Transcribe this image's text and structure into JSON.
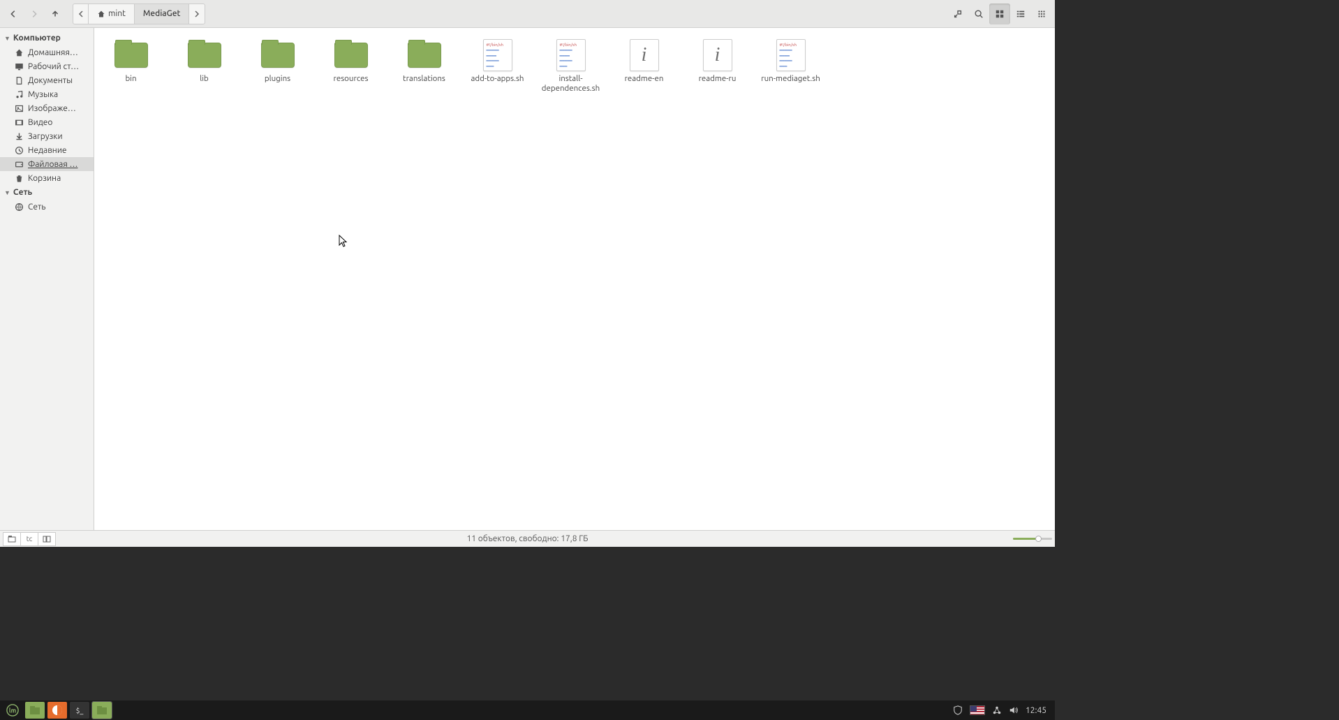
{
  "toolbar": {
    "path": {
      "parent": "mint",
      "current": "MediaGet"
    }
  },
  "sidebar": {
    "section_computer": "Компьютер",
    "section_network": "Сеть",
    "items_computer": [
      {
        "label": "Домашняя…",
        "icon": "home"
      },
      {
        "label": "Рабочий ст…",
        "icon": "desktop"
      },
      {
        "label": "Документы",
        "icon": "documents"
      },
      {
        "label": "Музыка",
        "icon": "music"
      },
      {
        "label": "Изображе…",
        "icon": "pictures"
      },
      {
        "label": "Видео",
        "icon": "video"
      },
      {
        "label": "Загрузки",
        "icon": "downloads"
      },
      {
        "label": "Недавние",
        "icon": "recent"
      },
      {
        "label": "Файловая …",
        "icon": "filesystem",
        "selected": true
      },
      {
        "label": "Корзина",
        "icon": "trash"
      }
    ],
    "items_network": [
      {
        "label": "Сеть",
        "icon": "network"
      }
    ]
  },
  "files": [
    {
      "name": "bin",
      "type": "folder"
    },
    {
      "name": "lib",
      "type": "folder"
    },
    {
      "name": "plugins",
      "type": "folder"
    },
    {
      "name": "resources",
      "type": "folder"
    },
    {
      "name": "translations",
      "type": "folder"
    },
    {
      "name": "add-to-apps.sh",
      "type": "script"
    },
    {
      "name": "install-dependences.sh",
      "type": "script"
    },
    {
      "name": "readme-en",
      "type": "info"
    },
    {
      "name": "readme-ru",
      "type": "info"
    },
    {
      "name": "run-mediaget.sh",
      "type": "script"
    }
  ],
  "statusbar": {
    "text": "11 объектов, свободно: 17,8 ГБ"
  },
  "tray": {
    "time": "12:45"
  }
}
